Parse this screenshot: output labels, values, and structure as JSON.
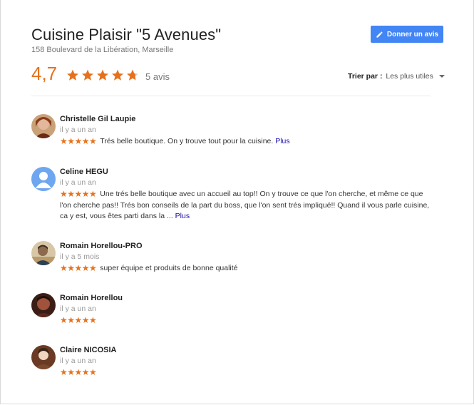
{
  "place": {
    "name": "Cuisine Plaisir \"5 Avenues\"",
    "address": "158 Boulevard de la Libération, Marseille"
  },
  "write_review_label": "Donner un avis",
  "rating": {
    "average": "4,7",
    "stars_value": 4.7,
    "stars_max": 5,
    "count_label": "5 avis",
    "star_color": "#e7711b"
  },
  "sort": {
    "label": "Trier par :",
    "value": "Les plus utiles"
  },
  "colors": {
    "accent_button": "#4285f4",
    "rating_orange": "#e7711b",
    "link_blue": "#1a0dab"
  },
  "reviews": [
    {
      "author": "Christelle Gil Laupie",
      "date": "il y a un an",
      "stars": "★★★★★",
      "text": "Trés belle boutique. On y trouve tout pour la cuisine.",
      "more": "Plus"
    },
    {
      "author": "Celine HEGU",
      "date": "il y a un an",
      "stars": "★★★★★",
      "text": "Une trés belle boutique avec un accueil au top!! On y trouve ce que l'on cherche, et même ce que l'on cherche pas!! Trés bon conseils de la part du boss, que l'on sent trés impliqué!! Quand il vous parle cuisine, ca y est, vous êtes parti dans la ...",
      "more": "Plus"
    },
    {
      "author": "Romain Horellou-PRO",
      "date": "il y a 5 mois",
      "stars": "★★★★★",
      "text": "super équipe et produits de bonne qualité",
      "more": ""
    },
    {
      "author": "Romain Horellou",
      "date": "il y a un an",
      "stars": "★★★★★",
      "text": "",
      "more": ""
    },
    {
      "author": "Claire NICOSIA",
      "date": "il y a un an",
      "stars": "★★★★★",
      "text": "",
      "more": ""
    }
  ]
}
